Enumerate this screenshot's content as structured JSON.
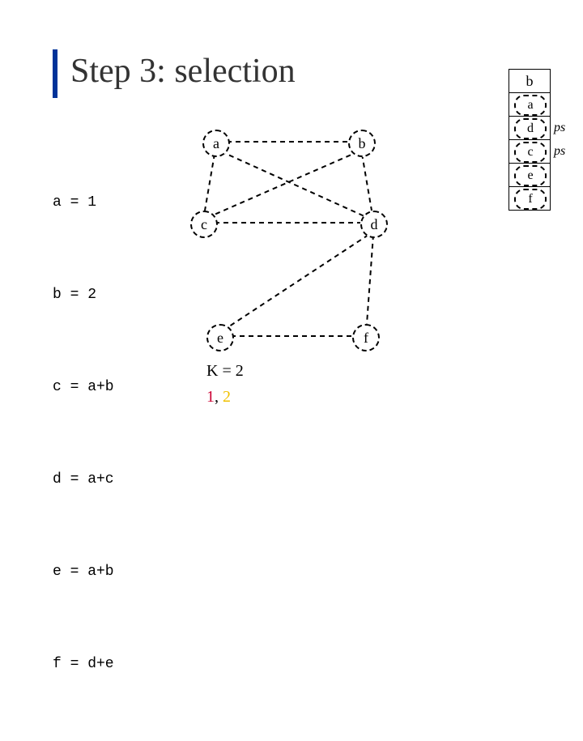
{
  "title": "Step 3: selection",
  "definitions": [
    "a = 1",
    "b = 2",
    "c = a+b",
    "d = a+c",
    "e = a+b",
    "f = d+e"
  ],
  "graph": {
    "nodes": {
      "a": "a",
      "b": "b",
      "c": "c",
      "d": "d",
      "e": "e",
      "f": "f"
    },
    "edges": [
      [
        "a",
        "b"
      ],
      [
        "a",
        "c"
      ],
      [
        "a",
        "d"
      ],
      [
        "b",
        "c"
      ],
      [
        "b",
        "d"
      ],
      [
        "c",
        "d"
      ],
      [
        "d",
        "e"
      ],
      [
        "d",
        "f"
      ],
      [
        "e",
        "f"
      ]
    ]
  },
  "k_text": "K = 2",
  "color_text": {
    "c1": "1",
    "sep": ", ",
    "c2": "2"
  },
  "stack": {
    "top": "b",
    "rows": [
      {
        "label": "a",
        "tag": ""
      },
      {
        "label": "d",
        "tag": "ps"
      },
      {
        "label": "c",
        "tag": "ps"
      },
      {
        "label": "e",
        "tag": ""
      },
      {
        "label": "f",
        "tag": ""
      }
    ]
  },
  "chart_data": {
    "type": "diagram",
    "title": "Graph-coloring register-allocation selection step",
    "interference_graph": {
      "nodes": [
        "a",
        "b",
        "c",
        "d",
        "e",
        "f"
      ],
      "edges": [
        [
          "a",
          "b"
        ],
        [
          "a",
          "c"
        ],
        [
          "a",
          "d"
        ],
        [
          "b",
          "c"
        ],
        [
          "b",
          "d"
        ],
        [
          "c",
          "d"
        ],
        [
          "d",
          "e"
        ],
        [
          "d",
          "f"
        ],
        [
          "e",
          "f"
        ]
      ]
    },
    "live_defs": {
      "a": "1",
      "b": "2",
      "c": "a+b",
      "d": "a+c",
      "e": "a+b",
      "f": "d+e"
    },
    "K": 2,
    "colors_available": [
      1,
      2
    ],
    "stack_order_pop": [
      "b",
      "a",
      "d",
      "c",
      "e",
      "f"
    ],
    "potential_spill": [
      "d",
      "c"
    ]
  }
}
